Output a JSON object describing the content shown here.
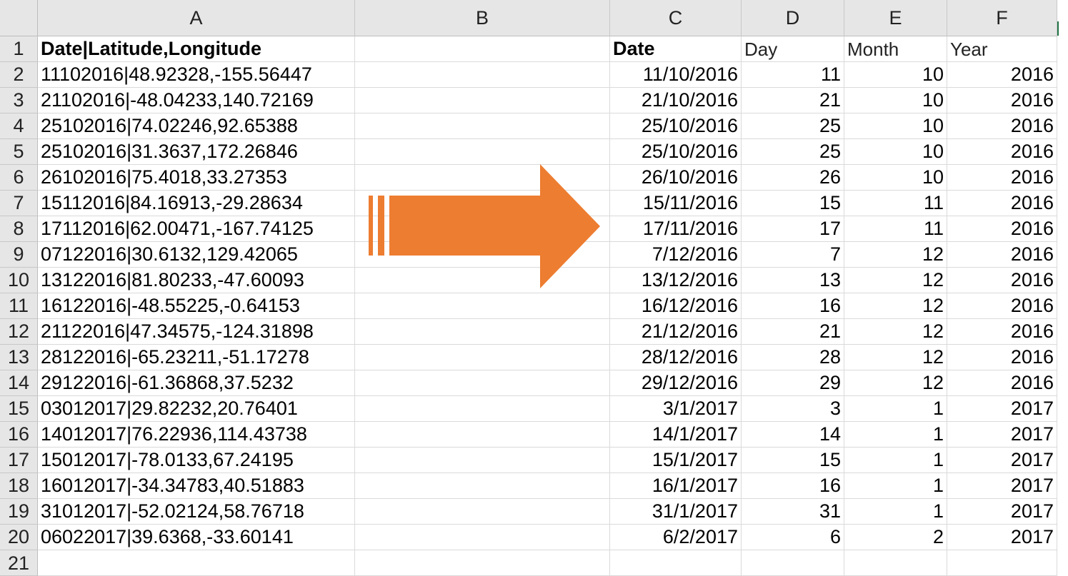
{
  "columns": [
    "A",
    "B",
    "C",
    "D",
    "E",
    "F"
  ],
  "header_row": {
    "row": "1",
    "A": "Date|Latitude,Longitude",
    "B": "",
    "C": "Date",
    "D": "Day",
    "E": "Month",
    "F": "Year"
  },
  "rows": [
    {
      "row": "2",
      "A": "11102016|48.92328,-155.56447",
      "C": "11/10/2016",
      "D": "11",
      "E": "10",
      "F": "2016"
    },
    {
      "row": "3",
      "A": "21102016|-48.04233,140.72169",
      "C": "21/10/2016",
      "D": "21",
      "E": "10",
      "F": "2016"
    },
    {
      "row": "4",
      "A": "25102016|74.02246,92.65388",
      "C": "25/10/2016",
      "D": "25",
      "E": "10",
      "F": "2016"
    },
    {
      "row": "5",
      "A": "25102016|31.3637,172.26846",
      "C": "25/10/2016",
      "D": "25",
      "E": "10",
      "F": "2016"
    },
    {
      "row": "6",
      "A": "26102016|75.4018,33.27353",
      "C": "26/10/2016",
      "D": "26",
      "E": "10",
      "F": "2016"
    },
    {
      "row": "7",
      "A": "15112016|84.16913,-29.28634",
      "C": "15/11/2016",
      "D": "15",
      "E": "11",
      "F": "2016"
    },
    {
      "row": "8",
      "A": "17112016|62.00471,-167.74125",
      "C": "17/11/2016",
      "D": "17",
      "E": "11",
      "F": "2016"
    },
    {
      "row": "9",
      "A": "07122016|30.6132,129.42065",
      "C": "7/12/2016",
      "D": "7",
      "E": "12",
      "F": "2016"
    },
    {
      "row": "10",
      "A": "13122016|81.80233,-47.60093",
      "C": "13/12/2016",
      "D": "13",
      "E": "12",
      "F": "2016"
    },
    {
      "row": "11",
      "A": "16122016|-48.55225,-0.64153",
      "C": "16/12/2016",
      "D": "16",
      "E": "12",
      "F": "2016"
    },
    {
      "row": "12",
      "A": "21122016|47.34575,-124.31898",
      "C": "21/12/2016",
      "D": "21",
      "E": "12",
      "F": "2016"
    },
    {
      "row": "13",
      "A": "28122016|-65.23211,-51.17278",
      "C": "28/12/2016",
      "D": "28",
      "E": "12",
      "F": "2016"
    },
    {
      "row": "14",
      "A": "29122016|-61.36868,37.5232",
      "C": "29/12/2016",
      "D": "29",
      "E": "12",
      "F": "2016"
    },
    {
      "row": "15",
      "A": "03012017|29.82232,20.76401",
      "C": "3/1/2017",
      "D": "3",
      "E": "1",
      "F": "2017"
    },
    {
      "row": "16",
      "A": "14012017|76.22936,114.43738",
      "C": "14/1/2017",
      "D": "14",
      "E": "1",
      "F": "2017"
    },
    {
      "row": "17",
      "A": "15012017|-78.0133,67.24195",
      "C": "15/1/2017",
      "D": "15",
      "E": "1",
      "F": "2017"
    },
    {
      "row": "18",
      "A": "16012017|-34.34783,40.51883",
      "C": "16/1/2017",
      "D": "16",
      "E": "1",
      "F": "2017"
    },
    {
      "row": "19",
      "A": "31012017|-52.02124,58.76718",
      "C": "31/1/2017",
      "D": "31",
      "E": "1",
      "F": "2017"
    },
    {
      "row": "20",
      "A": "06022017|39.6368,-33.60141",
      "C": "6/2/2017",
      "D": "6",
      "E": "2",
      "F": "2017"
    }
  ],
  "partial_row": "21",
  "icons": {
    "arrow": "arrow-right-icon"
  },
  "colors": {
    "arrow": "#ED7D31",
    "header_bg": "#E6E6E6",
    "grid": "#DADADA",
    "accent": "#217346"
  }
}
